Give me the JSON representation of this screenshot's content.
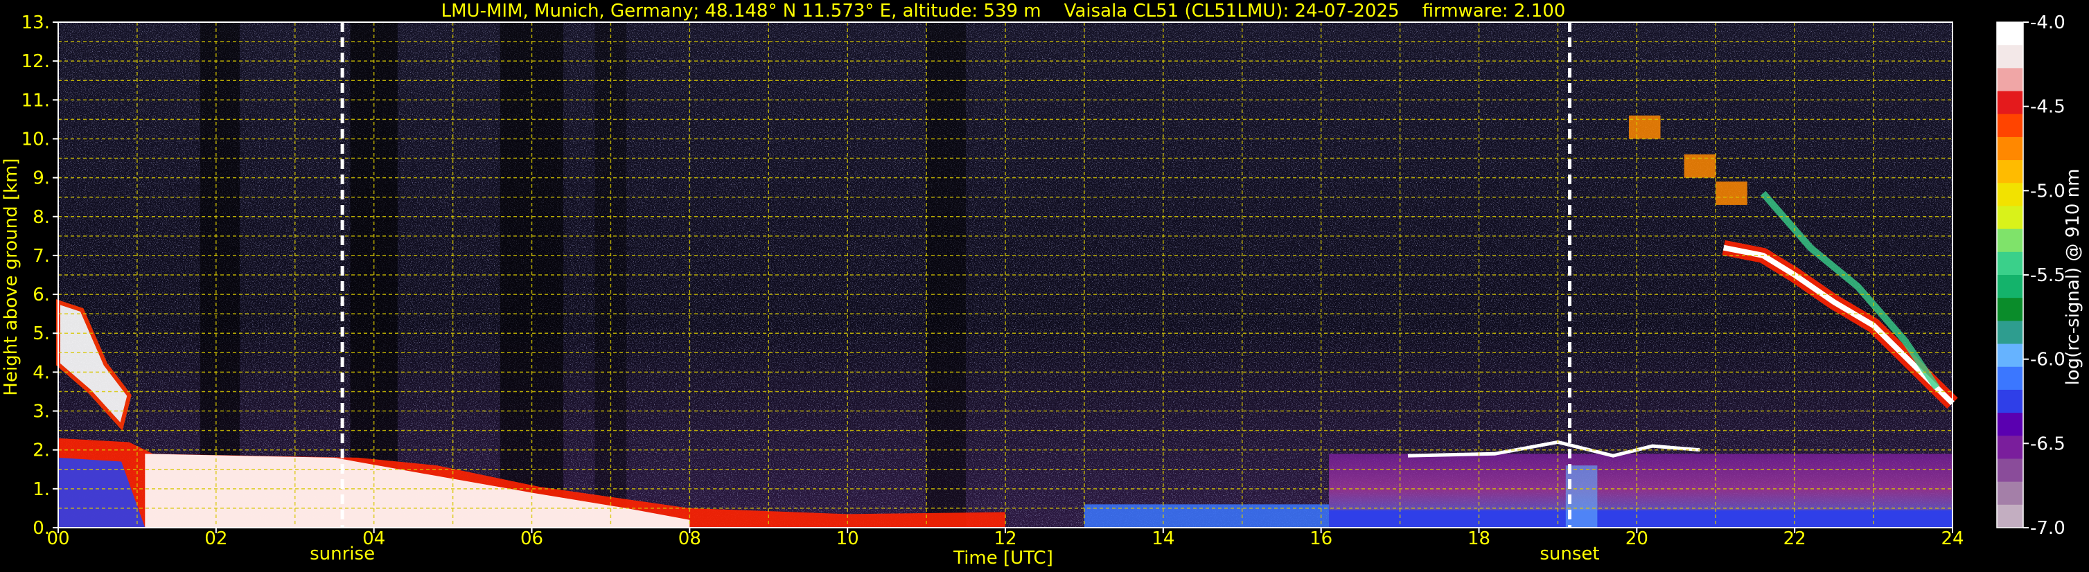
{
  "chart_data": {
    "type": "heatmap",
    "title": "LMU-MIM, Munich, Germany; 48.148° N 11.573° E, altitude: 539 m    Vaisala CL51 (CL51LMU): 24-07-2025    firmware: 2.100",
    "xlabel": "Time [UTC]",
    "ylabel": "Height above ground [km]",
    "xlim": [
      0,
      24
    ],
    "ylim": [
      0,
      13
    ],
    "x_ticks": [
      "00",
      "02",
      "04",
      "06",
      "08",
      "10",
      "12",
      "14",
      "16",
      "18",
      "20",
      "22",
      "24"
    ],
    "y_ticks": [
      "0.",
      "1.",
      "2.",
      "3.",
      "4.",
      "5.",
      "6.",
      "7.",
      "8.",
      "9.",
      "10.",
      "11.",
      "12.",
      "13."
    ],
    "grid": true,
    "colorbar": {
      "label": "log(rc-signal) @ 910 nm",
      "range": [
        -7.0,
        -4.0
      ],
      "ticks": [
        "-4.0",
        "-4.5",
        "-5.0",
        "-5.5",
        "-6.0",
        "-6.5",
        "-7.0"
      ],
      "tick_values": [
        -4.0,
        -4.5,
        -5.0,
        -5.5,
        -6.0,
        -6.5,
        -7.0
      ],
      "colors": [
        "#ffffff",
        "#f3e8e8",
        "#f0a6a6",
        "#e41a1c",
        "#ff4400",
        "#ff8800",
        "#ffbb00",
        "#f2e200",
        "#d9f21a",
        "#7fe36a",
        "#3ad08a",
        "#14b36b",
        "#0a8c2a",
        "#2e9d8f",
        "#66b3ff",
        "#3b77ff",
        "#2f3fe8",
        "#5a00b0",
        "#7a1e9c",
        "#8a4c9a",
        "#a47fa8",
        "#c3aec1"
      ]
    },
    "markers": [
      {
        "label": "sunrise",
        "x": 3.6
      },
      {
        "label": "sunset",
        "x": 19.15
      }
    ]
  }
}
